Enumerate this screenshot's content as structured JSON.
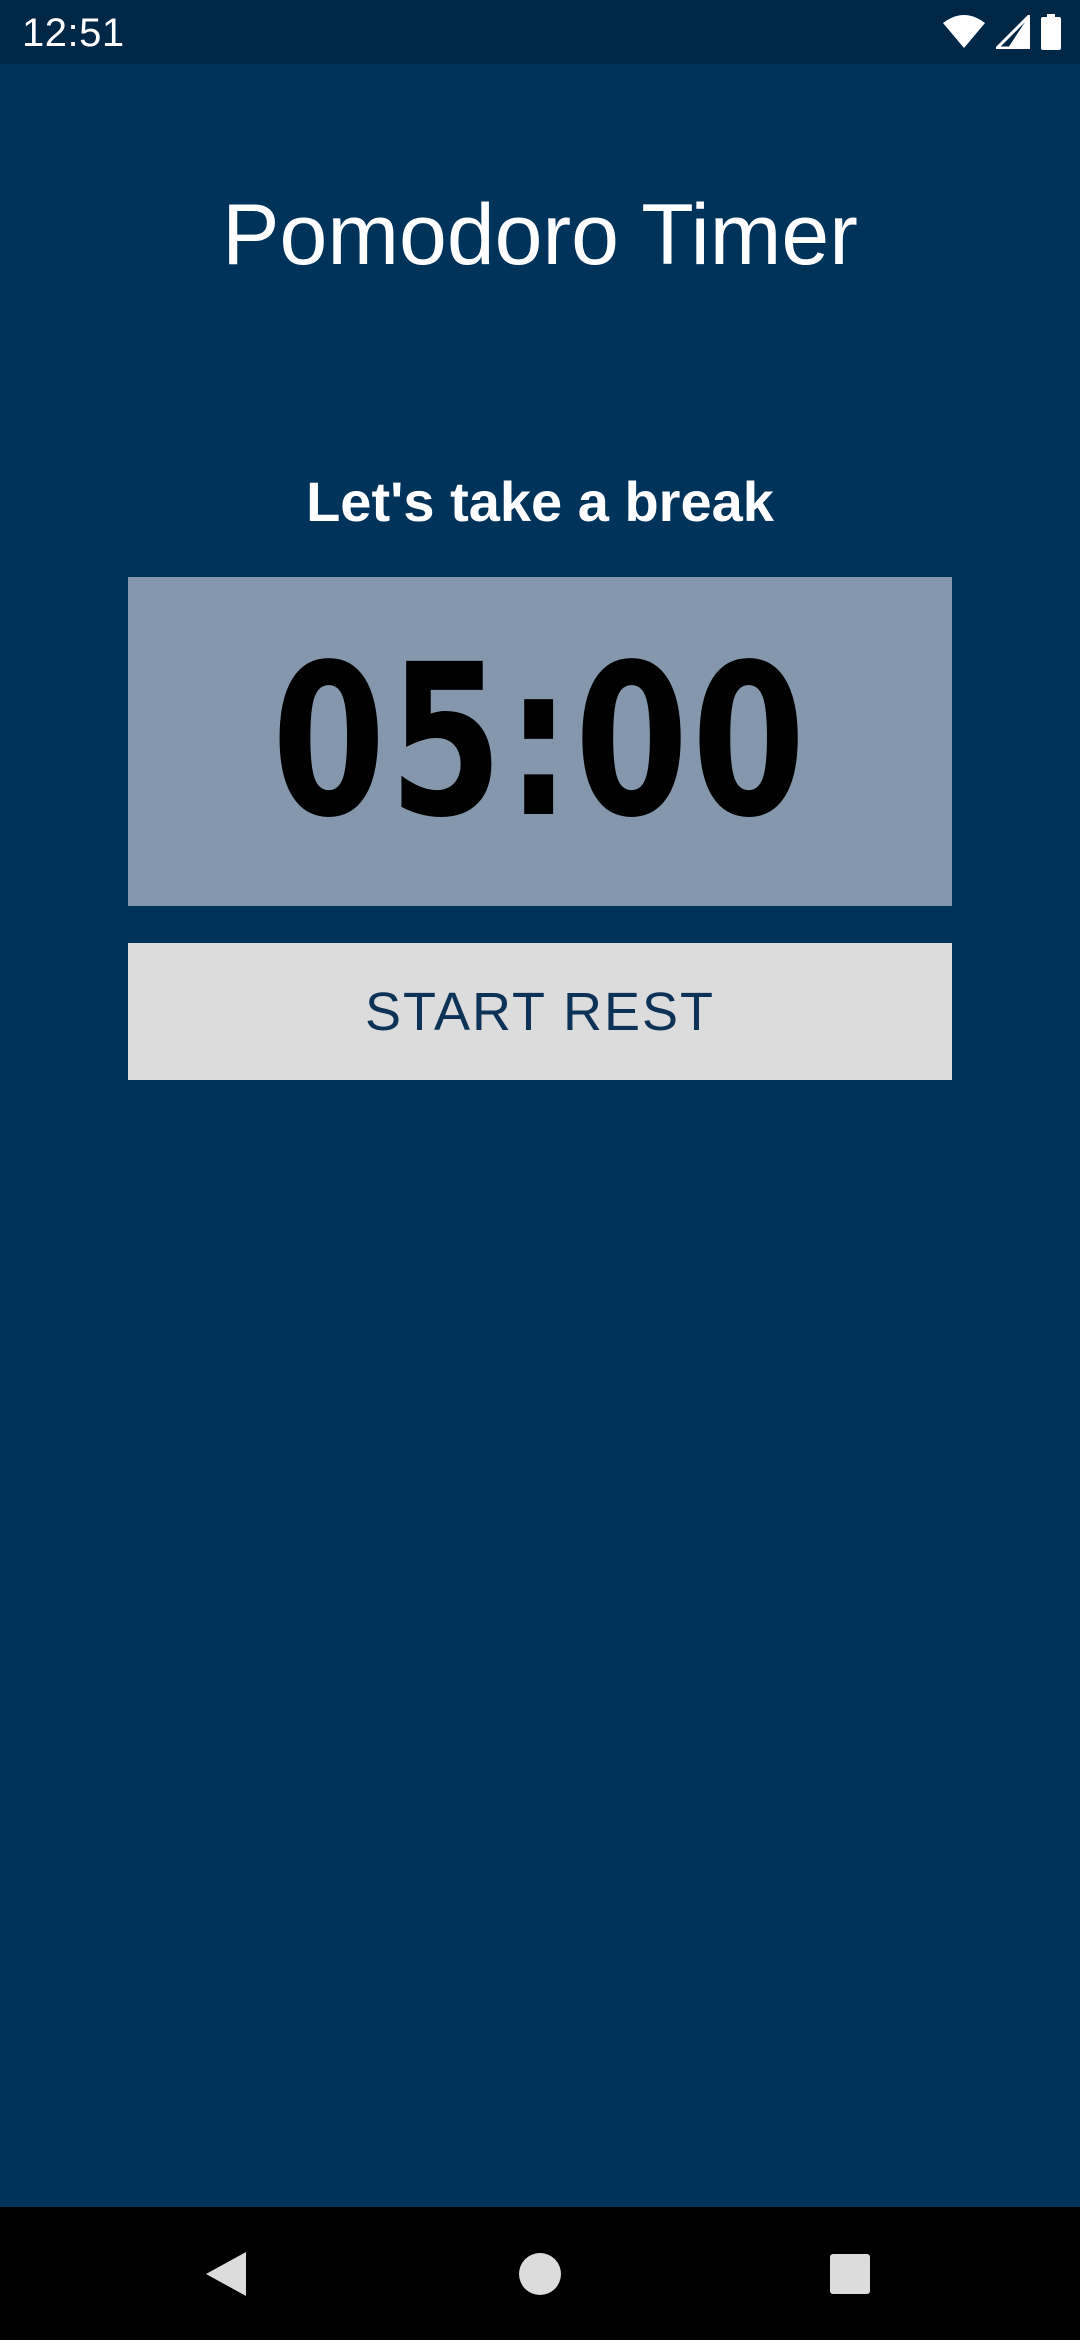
{
  "status_bar": {
    "time": "12:51",
    "icons": [
      "wifi-icon",
      "cellular-signal-icon",
      "battery-icon"
    ]
  },
  "app": {
    "title": "Pomodoro Timer",
    "subtitle": "Let's take a break",
    "timer_value": "05:00",
    "start_button_label": "START REST"
  },
  "navigation_bar": {
    "icons": [
      "back-icon",
      "home-icon",
      "recent-apps-icon"
    ]
  },
  "colors": {
    "background": "#003359",
    "status_bar": "#002746",
    "timer_box": "#8597ac",
    "button_background": "#dcdcdc",
    "button_text": "#0d3258",
    "navigation_bar": "#000000"
  }
}
